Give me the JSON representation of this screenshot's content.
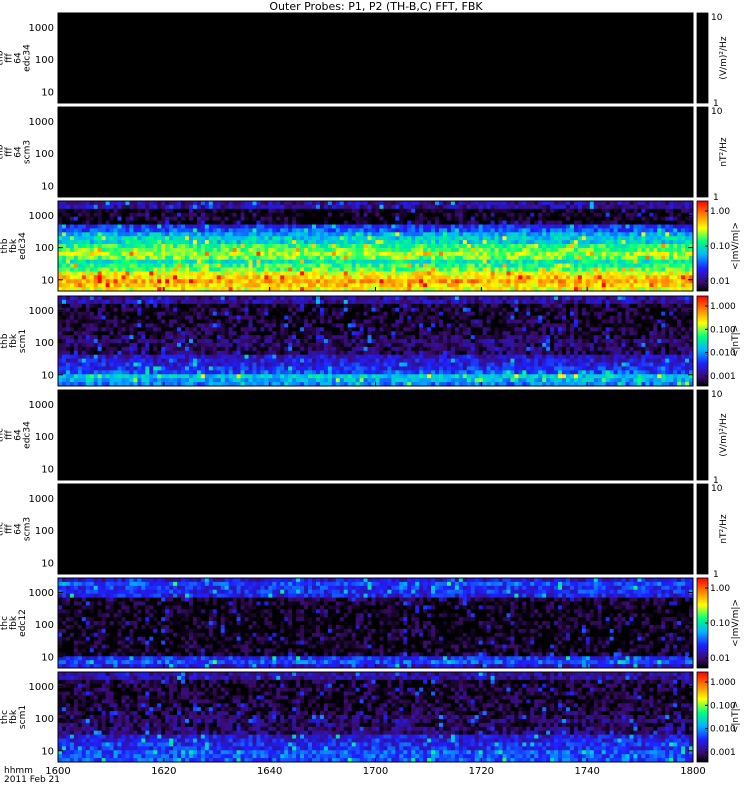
{
  "title": "Outer Probes: P1, P2 (TH-B,C) FFT, FBK",
  "colors": {
    "background": "#ffffff",
    "empty_panel": "#000000",
    "separator": "#ffffff"
  },
  "chart_data": {
    "type": "heatmap",
    "x_range": [
      960,
      1080
    ],
    "x_ticks": [
      {
        "value": 960,
        "label": "1600"
      },
      {
        "value": 980,
        "label": "1620"
      },
      {
        "value": 1000,
        "label": "1640"
      },
      {
        "value": 1020,
        "label": "1700"
      },
      {
        "value": 1040,
        "label": "1720"
      },
      {
        "value": 1060,
        "label": "1740"
      },
      {
        "value": 1080,
        "label": "1800"
      }
    ],
    "x_footer": [
      "hhmm",
      "2011 Feb 21"
    ],
    "y_scale": "log",
    "y_ticks": [
      "10",
      "100",
      "1000"
    ],
    "colorscale": "rainbow",
    "panels": [
      {
        "label": [
          "thb",
          "fff",
          "64",
          "edc34"
        ],
        "unit": "(V/m)²/Hz",
        "cbar_min": "1",
        "cbar_max": "10",
        "cbar_ticks": [],
        "has_data": false,
        "profile": []
      },
      {
        "label": [
          "thb",
          "fff",
          "64",
          "scm3"
        ],
        "unit": "nT²/Hz",
        "cbar_min": "1",
        "cbar_max": "10",
        "cbar_ticks": [],
        "has_data": false,
        "profile": []
      },
      {
        "label": [
          "thb",
          "fbk",
          "edc34"
        ],
        "unit": "<|mV/m|>",
        "cbar_min": "",
        "cbar_max": "",
        "cbar_ticks": [
          "1.00",
          "0.10",
          "0.01"
        ],
        "has_data": true,
        "profile": [
          0.15,
          0.15,
          0.02,
          0.02,
          0.02,
          0.02,
          0.25,
          0.3,
          0.4,
          0.45,
          0.45,
          0.55,
          0.6,
          0.65,
          0.6,
          0.5,
          0.55,
          0.6,
          0.7,
          0.75,
          0.8,
          0.75,
          0.7
        ]
      },
      {
        "label": [
          "thb",
          "fbk",
          "scm1"
        ],
        "unit": "<|nT|>",
        "cbar_min": "",
        "cbar_max": "",
        "cbar_ticks": [
          "1.000",
          "0.100",
          "0.010",
          "0.001"
        ],
        "has_data": true,
        "profile": [
          0.15,
          0.15,
          0.05,
          0.04,
          0.04,
          0.03,
          0.04,
          0.04,
          0.05,
          0.05,
          0.08,
          0.09,
          0.09,
          0.08,
          0.08,
          0.18,
          0.2,
          0.22,
          0.25,
          0.3,
          0.45,
          0.4,
          0.35
        ]
      },
      {
        "label": [
          "thc",
          "fff",
          "64",
          "edc34"
        ],
        "unit": "(V/m)²/Hz",
        "cbar_min": "1",
        "cbar_max": "10",
        "cbar_ticks": [],
        "has_data": false,
        "profile": []
      },
      {
        "label": [
          "thc",
          "fff",
          "64",
          "scm3"
        ],
        "unit": "nT²/Hz",
        "cbar_min": "1",
        "cbar_max": "10",
        "cbar_ticks": [],
        "has_data": false,
        "profile": []
      },
      {
        "label": [
          "thc",
          "fbk",
          "edc12"
        ],
        "unit": "<|mV/m|>",
        "cbar_min": "",
        "cbar_max": "",
        "cbar_ticks": [
          "1.00",
          "0.10",
          "0.01"
        ],
        "has_data": true,
        "profile": [
          0.2,
          0.3,
          0.25,
          0.25,
          0.22,
          0.05,
          0.03,
          0.02,
          0.02,
          0.02,
          0.02,
          0.02,
          0.02,
          0.02,
          0.02,
          0.02,
          0.02,
          0.02,
          0.02,
          0.03,
          0.25,
          0.3,
          0.2
        ]
      },
      {
        "label": [
          "thc",
          "fbk",
          "scm1"
        ],
        "unit": "<|nT|>",
        "cbar_min": "",
        "cbar_max": "",
        "cbar_ticks": [
          "1.000",
          "0.100",
          "0.010",
          "0.001"
        ],
        "has_data": true,
        "profile": [
          0.15,
          0.15,
          0.05,
          0.04,
          0.04,
          0.04,
          0.04,
          0.04,
          0.05,
          0.05,
          0.06,
          0.08,
          0.09,
          0.08,
          0.1,
          0.1,
          0.2,
          0.22,
          0.25,
          0.25,
          0.3,
          0.3,
          0.3
        ]
      }
    ]
  }
}
